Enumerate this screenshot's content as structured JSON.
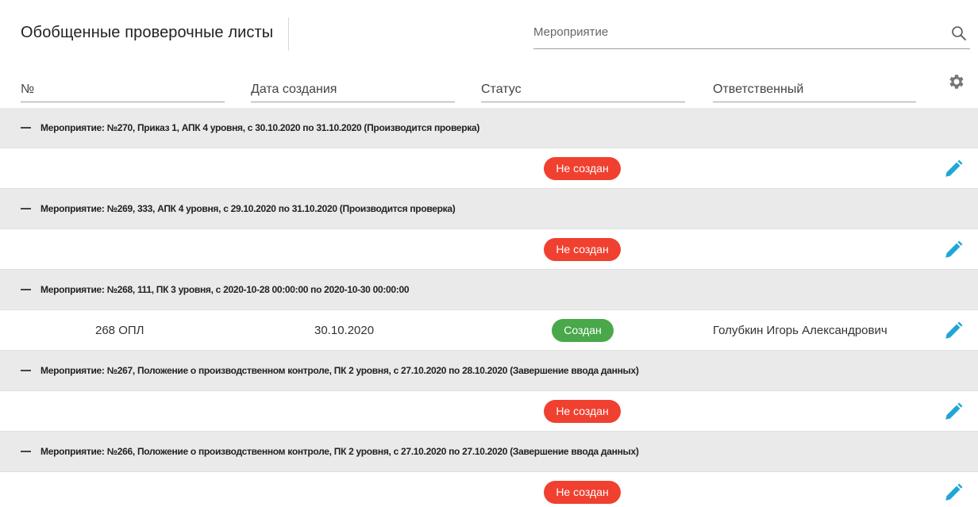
{
  "header": {
    "title": "Обобщенные проверочные листы",
    "search_placeholder": "Мероприятие"
  },
  "columns": {
    "no": "№",
    "date": "Дата создания",
    "status": "Статус",
    "responsible": "Ответственный"
  },
  "colors": {
    "status_not_created": "#f0402f",
    "status_created": "#48a84a",
    "edit_icon": "#1ea7d6",
    "group_bg": "#eaeaea"
  },
  "groups": [
    {
      "label": "Мероприятие:",
      "text": "№270, Приказ 1, АПК 4 уровня, с 30.10.2020 по 31.10.2020 (Производится проверка)",
      "row": {
        "no": "",
        "date": "",
        "status": "Не создан",
        "responsible": ""
      }
    },
    {
      "label": "Мероприятие:",
      "text": "№269, 333, АПК 4 уровня, с 29.10.2020 по 31.10.2020 (Производится проверка)",
      "row": {
        "no": "",
        "date": "",
        "status": "Не создан",
        "responsible": ""
      }
    },
    {
      "label": "Мероприятие:",
      "text": "№268, 111, ПК 3 уровня, с 2020-10-28 00:00:00 по 2020-10-30 00:00:00",
      "row": {
        "no": "268 ОПЛ",
        "date": "30.10.2020",
        "status": "Создан",
        "responsible": "Голубкин Игорь Александрович"
      }
    },
    {
      "label": "Мероприятие:",
      "text": "№267, Положение о производственном контроле, ПК 2 уровня, с 27.10.2020 по 28.10.2020 (Завершение ввода данных)",
      "row": {
        "no": "",
        "date": "",
        "status": "Не создан",
        "responsible": ""
      }
    },
    {
      "label": "Мероприятие:",
      "text": "№266, Положение о производственном контроле, ПК 2 уровня, с 27.10.2020 по 27.10.2020 (Завершение ввода данных)",
      "row": {
        "no": "",
        "date": "",
        "status": "Не создан",
        "responsible": ""
      }
    }
  ]
}
